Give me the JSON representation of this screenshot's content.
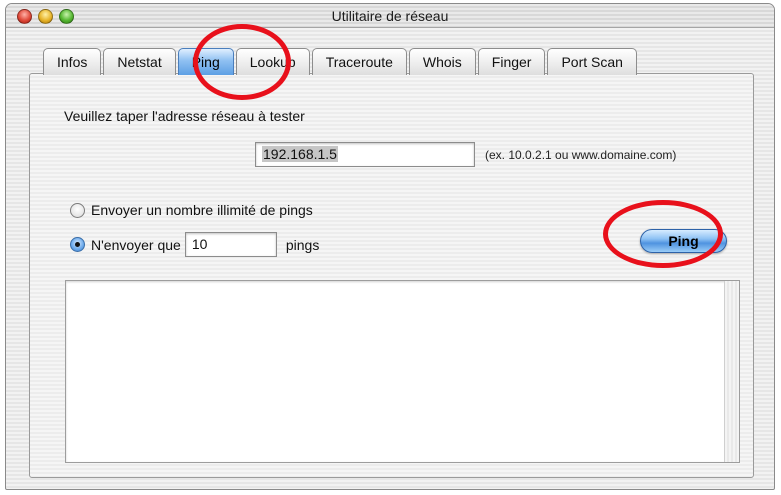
{
  "window": {
    "title": "Utilitaire de réseau"
  },
  "tabs": [
    {
      "label": "Infos",
      "selected": false
    },
    {
      "label": "Netstat",
      "selected": false
    },
    {
      "label": "Ping",
      "selected": true
    },
    {
      "label": "Lookup",
      "selected": false
    },
    {
      "label": "Traceroute",
      "selected": false
    },
    {
      "label": "Whois",
      "selected": false
    },
    {
      "label": "Finger",
      "selected": false
    },
    {
      "label": "Port Scan",
      "selected": false
    }
  ],
  "ping": {
    "prompt": "Veuillez taper l'adresse réseau à tester",
    "address_value": "192.168.1.5",
    "address_hint": "(ex. 10.0.2.1 ou www.domaine.com)",
    "option_unlimited": "Envoyer un nombre illimité de pings",
    "option_limited_prefix": "N'envoyer que",
    "count_value": "10",
    "option_limited_suffix": "pings",
    "selected_option": "limited",
    "button_label": "Ping"
  },
  "colors": {
    "highlight": "#e8101b",
    "selected_tab": "#5d9fe4"
  }
}
